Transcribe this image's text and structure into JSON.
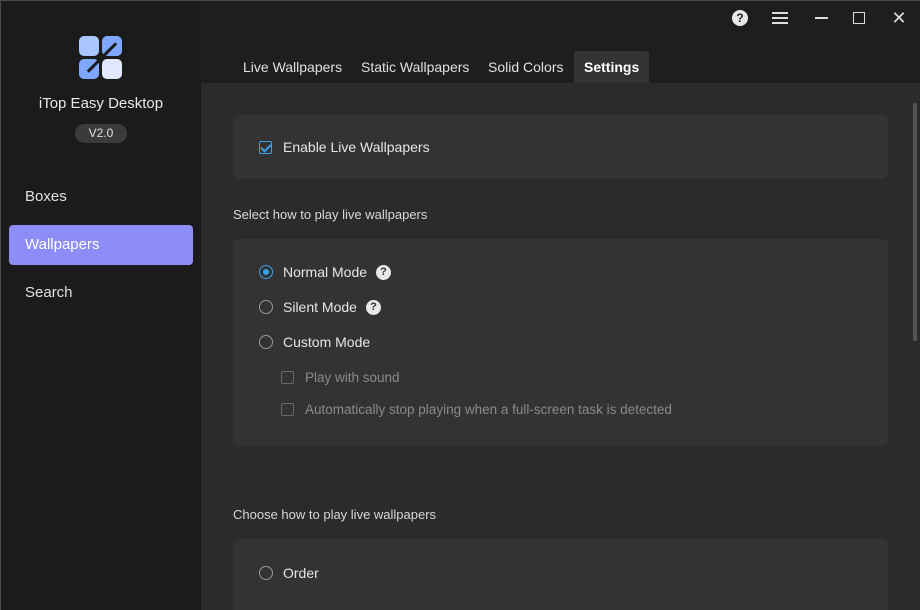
{
  "sidebar": {
    "app_name": "iTop Easy Desktop",
    "version": "V2.0",
    "items": [
      {
        "label": "Boxes"
      },
      {
        "label": "Wallpapers"
      },
      {
        "label": "Search"
      }
    ]
  },
  "window_controls": {
    "help": "?",
    "close": "✕"
  },
  "tabs": [
    {
      "label": "Live Wallpapers"
    },
    {
      "label": "Static Wallpapers"
    },
    {
      "label": "Solid Colors"
    },
    {
      "label": "Settings"
    }
  ],
  "settings": {
    "enable_live": {
      "label": "Enable Live Wallpapers",
      "checked": true
    },
    "play_section_title": "Select how to play live wallpapers",
    "modes": [
      {
        "label": "Normal Mode",
        "selected": true
      },
      {
        "label": "Silent Mode",
        "selected": false
      },
      {
        "label": "Custom Mode",
        "selected": false
      }
    ],
    "help_glyph": "?",
    "custom_options": [
      {
        "label": "Play with sound",
        "checked": false
      },
      {
        "label": "Automatically stop playing when a full-screen task is detected",
        "checked": false
      }
    ],
    "order_section_title": "Choose how to play live wallpapers",
    "order_options": [
      {
        "label": "Order",
        "selected": false
      }
    ]
  },
  "colors": {
    "accent": "#8c8df7",
    "check": "#3aa0e8"
  }
}
